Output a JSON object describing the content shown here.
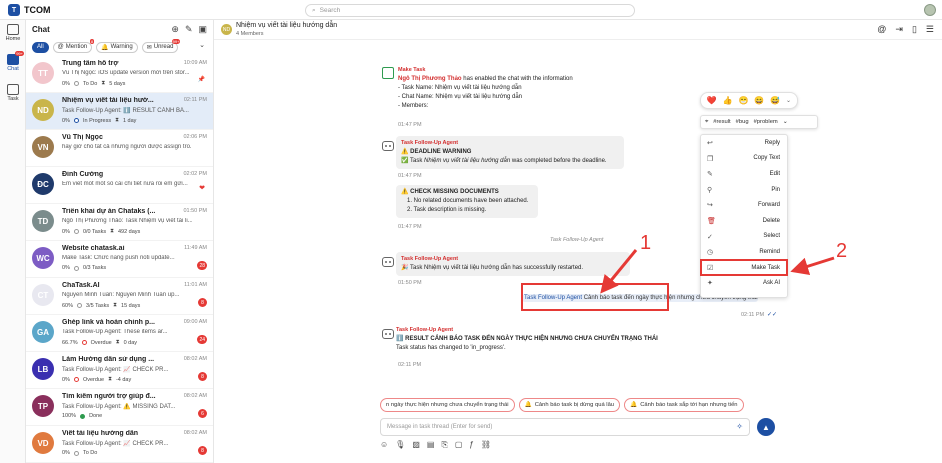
{
  "app": {
    "name": "TCOM",
    "logo": "T"
  },
  "search": {
    "placeholder": "Search"
  },
  "rail": [
    {
      "label": "Home",
      "icon": "home-icon"
    },
    {
      "label": "Chat",
      "icon": "chat-icon",
      "badge": "99+"
    },
    {
      "label": "Task",
      "icon": "task-icon"
    }
  ],
  "chat_list": {
    "title": "Chat",
    "filters": [
      {
        "label": "All"
      },
      {
        "label": "Mention",
        "badge": "8"
      },
      {
        "label": "Warning"
      },
      {
        "label": "Unread",
        "badge": "99+"
      }
    ],
    "conversations": [
      {
        "title": "Trung tâm hỗ trợ",
        "time": "10:09 AM",
        "preview": "Vũ Thị Ngọc: iOS update version mới trên stor...",
        "meta_pct": "0%",
        "meta_status": "To Do",
        "meta_days": "5 days",
        "avatar": "TT",
        "color": "#f2c6cc"
      },
      {
        "title": "Nhiệm vụ viết tài liệu hướ...",
        "time": "02:11 PM",
        "preview": "Task Follow-Up Agent: ℹ️ RESULT CẢNH BÁ...",
        "meta_pct": "0%",
        "meta_status": "In Progress",
        "meta_days": "1 day",
        "avatar": "ND",
        "color": "#c9b54a"
      },
      {
        "title": "Vũ Thị Ngọc",
        "time": "02:06 PM",
        "preview": "hay giờ cho tất cả những người được assign tro...",
        "avatar": "VN",
        "color": "#9c7a4d"
      },
      {
        "title": "Đinh Cường",
        "time": "02:02 PM",
        "preview": "Em viết mốt mốt số cái chi tiết nữa rồi em gửi...",
        "avatar": "ĐC",
        "color": "#1f3a6b"
      },
      {
        "title": "Triển khai dự án Chataks (...",
        "time": "01:50 PM",
        "preview": "Ngô Thị Phương Thảo: Task Nhiệm vụ viết tài li...",
        "meta_pct": "0%",
        "meta_status": "0/0 Tasks",
        "meta_days": "492 days",
        "avatar": "TD",
        "color": "#7b8c8c"
      },
      {
        "title": "Website chatask.ai",
        "time": "11:49 AM",
        "preview": "Make Task: Chức năng push noti update...",
        "meta_pct": "0%",
        "meta_status": "0/3 Tasks",
        "badge": "28",
        "avatar": "WC",
        "color": "#7d5cc4"
      },
      {
        "title": "ChaTask.AI",
        "time": "11:01 AM",
        "preview": "Nguyễn Minh Tuấn: Nguyễn Minh Tuấn up...",
        "meta_pct": "60%",
        "meta_status": "3/5 Tasks",
        "meta_days": "15 days",
        "badge": "8",
        "avatar": "CT",
        "color": "#e8e8f0"
      },
      {
        "title": "Ghép link và hoàn chỉnh p...",
        "time": "09:00 AM",
        "preview": "Task Follow-Up Agent: These items ar...",
        "meta_pct": "66.7%",
        "meta_status": "Overdue",
        "meta_days": "0 day",
        "badge": "24",
        "avatar": "GA",
        "color": "#5ba6c9"
      },
      {
        "title": "Làm Hướng dẫn sử dụng ...",
        "time": "08:02 AM",
        "preview": "Task Follow-Up Agent: 📈 CHECK PR...",
        "meta_pct": "0%",
        "meta_status": "Overdue",
        "meta_days": "-4 day",
        "badge": "8",
        "avatar": "LB",
        "color": "#3a2fb0"
      },
      {
        "title": "Tìm kiếm người trợ giúp đ...",
        "time": "08:02 AM",
        "preview": "Task Follow-Up Agent: ⚠️ MISSING DAT...",
        "meta_pct": "100%",
        "meta_status": "Done",
        "badge": "6",
        "avatar": "TP",
        "color": "#8a2f5c"
      },
      {
        "title": "Viết tài liệu hướng dẫn",
        "time": "08:02 AM",
        "preview": "Task Follow-Up Agent: 📈 CHECK PR...",
        "meta_pct": "0%",
        "meta_status": "To Do",
        "badge": "8",
        "avatar": "VD",
        "color": "#e07a3f"
      }
    ]
  },
  "chat_header": {
    "avatar": "ND",
    "title": "Nhiệm vụ viết tài liệu hướng dẫn",
    "subtitle": "4 Members"
  },
  "messages": {
    "m1": {
      "sender": "Make Task",
      "name": "Ngô Thị Phương Thảo",
      "line1": " has enabled the chat with the information",
      "line2": "- Task Name: Nhiệm vụ viết tài liệu hướng dẫn",
      "line3": "- Chat Name: Nhiệm vụ viết tài liệu hướng dẫn",
      "line4": "- Members:",
      "time": "01:47 PM"
    },
    "m2": {
      "sender": "Task Follow-Up Agent",
      "title": "⚠️ DEADLINE WARNING",
      "pre": "✅ Task ",
      "task": "Nhiệm vụ viết tài liệu hướng dẫn",
      "post": " was completed before the deadline.",
      "time": "01:47 PM"
    },
    "m3": {
      "title": "⚠️ CHECK MISSING DOCUMENTS",
      "item1": "1. No related documents have been attached.",
      "item2": "2. Task description is missing.",
      "time": "01:47 PM"
    },
    "note": "Task Follow-Up Agent",
    "m4": {
      "sender": "Task Follow-Up Agent",
      "text": "🎉 Task Nhiệm vụ viết tài liệu hướng dẫn has successfully restarted.",
      "time": "01:50 PM"
    },
    "out": {
      "link": "Task Follow-Up Agent",
      "text": " Cảnh báo task đến ngày thực hiện nhưng chưa chuyển trạng thái",
      "time": "02:11 PM"
    },
    "m5": {
      "sender": "Task Follow-Up Agent",
      "title": "ℹ️ RESULT CẢNH BÁO TASK ĐẾN NGÀY THỰC HIỆN NHƯNG CHƯA CHUYỂN TRẠNG THÁI",
      "text": "Task status has changed to 'in_progress'.",
      "time": "02:11 PM"
    }
  },
  "reactions": [
    "❤️",
    "👍",
    "😁",
    "😄",
    "😅"
  ],
  "tags": [
    "#result",
    "#bug",
    "#problem"
  ],
  "context_menu": [
    {
      "label": "Reply",
      "icon": "reply-icon",
      "glyph": "↩"
    },
    {
      "label": "Copy Text",
      "icon": "copy-icon",
      "glyph": "❐"
    },
    {
      "label": "Edit",
      "icon": "edit-icon",
      "glyph": "✎"
    },
    {
      "label": "Pin",
      "icon": "pin-icon",
      "glyph": "⚲"
    },
    {
      "label": "Forward",
      "icon": "forward-icon",
      "glyph": "↪"
    },
    {
      "label": "Delete",
      "icon": "trash-icon",
      "glyph": "🗑"
    },
    {
      "label": "Select",
      "icon": "select-icon",
      "glyph": "✓"
    },
    {
      "label": "Remind",
      "icon": "clock-icon",
      "glyph": "◷"
    },
    {
      "label": "Make Task",
      "icon": "task-icon",
      "glyph": "☑"
    },
    {
      "label": "Ask AI",
      "icon": "sparkle-icon",
      "glyph": "✦"
    }
  ],
  "annotations": {
    "one": "1",
    "two": "2"
  },
  "quick_replies": [
    "n ngày thực hiện nhưng chưa chuyển trạng thái",
    "Cảnh báo task bị dừng quá lâu",
    "Cảnh báo task sắp tới hạn nhưng tiến"
  ],
  "composer": {
    "placeholder": "Message in task thread (Enter for send)"
  },
  "colors": {
    "accent": "#1d4fa3",
    "alert": "#e53935",
    "selected_row": "#e3ecf8"
  }
}
